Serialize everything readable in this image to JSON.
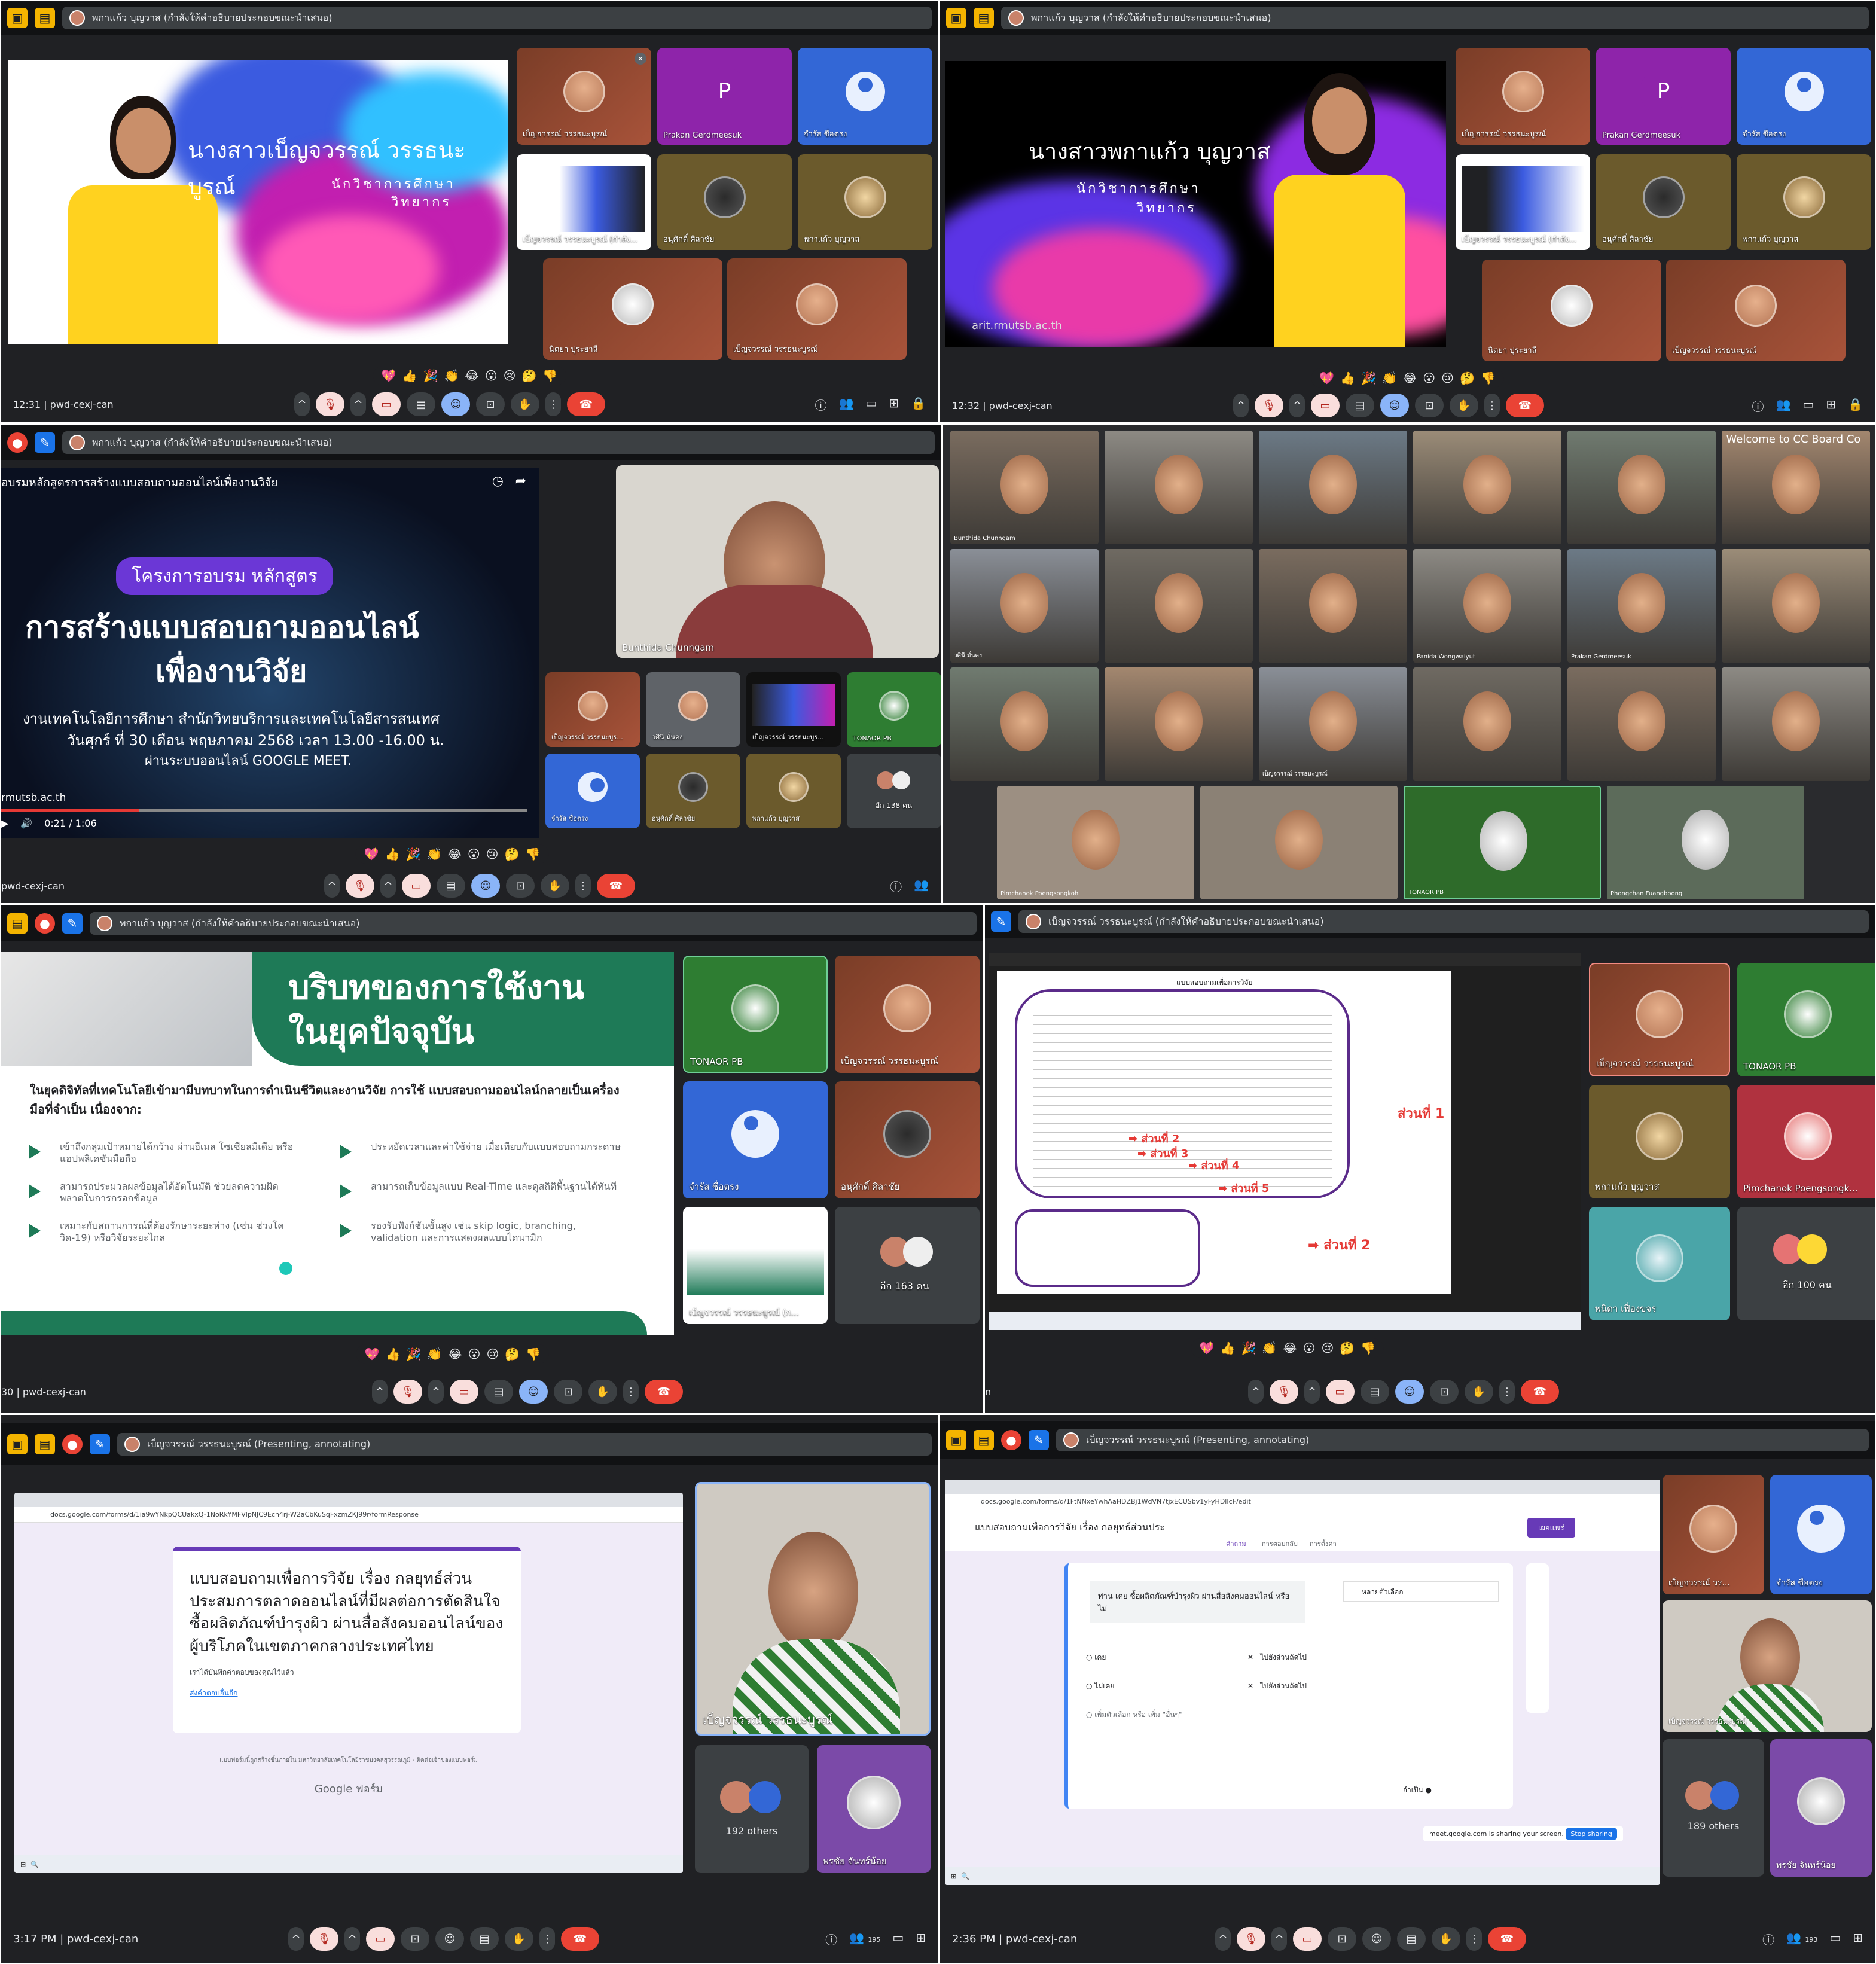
{
  "panel1": {
    "presenter_bar": "พกาแก้ว บุญวาส (กำลังให้คำอธิบายประกอบขณะนำเสนอ)",
    "slide_name": "นางสาวเบ็ญจวรรณ์ วรรธนะบูรณ์",
    "slide_role1": "นักวิชาการศึกษา",
    "slide_role2": "วิทยากร",
    "tiles": [
      "เบ็ญจวรรณ์ วรรธนะบูรณ์",
      "Prakan Gerdmeesuk",
      "จำรัส ซื่อตรง",
      "เบ็ญจวรรณ์ วรรธนะบูรณ์ (กำลัง...",
      "อนุศักดิ์ ศิลาชัย",
      "พกาแก้ว บุญวาส",
      "นิตยา ปุระยาลี",
      "เบ็ญจวรรณ์ วรรธนะบูรณ์"
    ],
    "tile_letter": "P",
    "time": "12:31",
    "meet_code": "pwd-cexj-can"
  },
  "panel2": {
    "presenter_bar": "พกาแก้ว บุญวาส (กำลังให้คำอธิบายประกอบขณะนำเสนอ)",
    "slide_name": "นางสาวพกาแก้ว บุญวาส",
    "slide_role1": "นักวิชาการศึกษา",
    "slide_role2": "วิทยากร",
    "slide_url": "arit.rmutsb.ac.th",
    "tiles": [
      "เบ็ญจวรรณ์ วรรธนะบูรณ์",
      "Prakan Gerdmeesuk",
      "จำรัส ซื่อตรง",
      "เบ็ญจวรรณ์ วรรธนะบูรณ์ (กำลัง...",
      "อนุศักดิ์ ศิลาชัย",
      "พกาแก้ว บุญวาส",
      "นิตยา ปุระยาลี",
      "เบ็ญจวรรณ์ วรรธนะบูรณ์"
    ],
    "tile_letter": "P",
    "time": "12:32",
    "meet_code": "pwd-cexj-can"
  },
  "panel3": {
    "presenter_bar": "พกาแก้ว บุญวาส (กำลังให้คำอธิบายประกอบขณะนำเสนอ)",
    "video_title": "อบรมหลักสูตรการสร้างแบบสอบถามออนไลน์เพื่องานวิจัย",
    "badge": "โครงการอบรม หลักสูตร",
    "heading1": "การสร้างแบบสอบถามออนไลน์",
    "heading2": "เพื่องานวิจัย",
    "line1": "งานเทคโนโลยีการศึกษา สำนักวิทยบริการและเทคโนโลยีสารสนเทศ",
    "line2": "วันศุกร์ ที่ 30 เดือน พฤษภาคม 2568 เวลา 13.00 -16.00 น.",
    "line3": "ผ่านระบบออนไลน์ GOOGLE MEET.",
    "url_fragment": "rmutsb.ac.th",
    "video_time": "0:21 / 1:06",
    "main_tile_name": "Bunthida Chunngam",
    "tiles": [
      "เบ็ญจวรรณ์ วรรธนะบูร...",
      "วศินี มั่นคง",
      "เบ็ญจวรรณ์ วรรธนะบูร...",
      "TONAOR PB",
      "จำรัส ซื่อตรง",
      "อนุศักดิ์ ศิลาชัย",
      "พกาแก้ว บุญวาส",
      "อีก 138 คน"
    ],
    "meet_code": "pwd-cexj-can"
  },
  "panel4": {
    "names": [
      "Bunthida Chunngam",
      "",
      "",
      "",
      "",
      "",
      "วศินี มั่นคง",
      "",
      "",
      "Panida Wongwaiyut",
      "Prakan Gerdmeesuk",
      "",
      "",
      "",
      "เบ็ญจวรรณ์ วรรธนะบูรณ์",
      "",
      "",
      "",
      "Pimchanok Poengsongkoh",
      "",
      "TONAOR PB",
      "Phongchan Fuangboong"
    ],
    "wall_text": "Welcome to CC Board Co"
  },
  "panel5": {
    "presenter_bar": "พกาแก้ว บุญวาส (กำลังให้คำอธิบายประกอบขณะนำเสนอ)",
    "banner_line1": "บริบทของการใช้งาน",
    "banner_line2": "ในยุคปัจจุบัน",
    "intro": "ในยุคดิจิทัลที่เทคโนโลยีเข้ามามีบทบาทในการดำเนินชีวิตและงานวิจัย การใช้ แบบสอบถามออนไลน์กลายเป็นเครื่องมือที่จำเป็น เนื่องจาก:",
    "bullets_left": [
      "เข้าถึงกลุ่มเป้าหมายได้กว้าง ผ่านอีเมล โซเชียลมีเดีย หรือแอปพลิเคชันมือถือ",
      "สามารถประมวลผลข้อมูลได้อัตโนมัติ ช่วยลดความผิดพลาดในการกรอกข้อมูล",
      "เหมาะกับสถานการณ์ที่ต้องรักษาระยะห่าง (เช่น ช่วงโควิด-19) หรือวิจัยระยะไกล"
    ],
    "bullets_right": [
      "ประหยัดเวลาและค่าใช้จ่าย เมื่อเทียบกับแบบสอบถามกระดาษ",
      "สามารถเก็บข้อมูลแบบ Real-Time และดูสถิติพื้นฐานได้ทันที",
      "รองรับฟังก์ชันขั้นสูง เช่น skip logic, branching, validation และการแสดงผลแบบไดนามิก"
    ],
    "tiles": [
      "TONAOR PB",
      "เบ็ญจวรรณ์ วรรธนะบูรณ์",
      "จำรัส ซื่อตรง",
      "อนุศักดิ์ ศิลาชัย",
      "เบ็ญจวรรณ์ วรรธนะบูรณ์ (ก...",
      "อีก 163 คน"
    ],
    "time_fragment": "30",
    "meet_code": "pwd-cexj-can"
  },
  "panel6": {
    "presenter_bar": "เบ็ญจวรรณ์ วรรธนะบูรณ์ (กำลังให้คำอธิบายประกอบขณะนำเสนอ)",
    "doc_title": "แบบสอบถามเพื่อการวิจัย",
    "labels": [
      "ส่วนที่ 1",
      "ส่วนที่ 2",
      "ส่วนที่ 2",
      "ส่วนที่ 3",
      "ส่วนที่ 4",
      "ส่วนที่ 5"
    ],
    "tiles": [
      "เบ็ญจวรรณ์ วรรธนะบูรณ์",
      "TONAOR PB",
      "พกาแก้ว บุญวาส",
      "Pimchanok Poengsongk...",
      "พนิดา เฟื่องขจร",
      "อีก 100 คน"
    ],
    "time_fragment": "n",
    "meet_code": ""
  },
  "panel7": {
    "presenter_bar": "เบ็ญจวรรณ์ วรรธนะบูรณ์ (Presenting, annotating)",
    "url": "docs.google.com/forms/d/1ia9wYNkpQCUakxQ-1NoRkYMFVlpNJC9Ech4rj-W2aCbKuSqFxzmZKJ99r/formResponse",
    "form_title": "แบบสอบถามเพื่อการวิจัย เรื่อง กลยุทธ์ส่วนประสมการตลาดออนไลน์ที่มีผลต่อการตัดสินใจซื้อผลิตภัณฑ์บำรุงผิว ผ่านสื่อสังคมออนไลน์ของผู้บริโภคในเขตภาคกลางประเทศไทย",
    "form_note": "เราได้บันทึกคำตอบของคุณไว้แล้ว",
    "form_link": "ส่งคำตอบอื่นอีก",
    "footer_note": "แบบฟอร์มนี้ถูกสร้างขึ้นภายใน มหาวิทยาลัยเทคโนโลยีราชมงคลสุวรรณภูมิ - ติดต่อเจ้าของแบบฟอร์ม",
    "google_forms": "Google ฟอร์ม",
    "main_tile_name": "เบ็ญจวรรณ์ วรรธนะบูรณ์",
    "others": "192 others",
    "tile_name": "พรชัย จันทร์น้อย",
    "time": "3:17 PM",
    "meet_code": "pwd-cexj-can",
    "count": "195"
  },
  "panel8": {
    "presenter_bar": "เบ็ญจวรรณ์ วรรธนะบูรณ์ (Presenting, annotating)",
    "url": "docs.google.com/forms/d/1FtNNxeYwhAaHDZBj1WdVN7tjxECUSbv1yFyHDlIcF/edit",
    "form_title": "แบบสอบถามเพื่อการวิจัย เรื่อง กลยุทธ์ส่วนประ",
    "tabs": [
      "คำถาม",
      "การตอบกลับ",
      "การตั้งค่า"
    ],
    "question": "ท่าน เคย ซื้อผลิตภัณฑ์บำรุงผิว ผ่านสื่อสังคมออนไลน์ หรือไม่",
    "type": "หลายตัวเลือก",
    "options": [
      "เคย",
      "ไม่เคย"
    ],
    "goto": [
      "ไปยังส่วนถัดไป",
      "ไปยังส่วนถัดไป"
    ],
    "add_option": "เพิ่มตัวเลือก หรือ เพิ่ม \"อื่นๆ\"",
    "required": "จำเป็น",
    "send_button": "เผยแพร่",
    "sharing_text": "meet.google.com is sharing your screen.",
    "stop_sharing": "Stop sharing",
    "tiles": [
      "เบ็ญจวรรณ์ วร...",
      "จำรัส ซื่อตรง",
      "เบ็ญจวรรณ์ วรรธนะบูรณ์",
      "พรชัย จันทร์น้อย"
    ],
    "others": "189 others",
    "time": "2:36 PM",
    "meet_code": "pwd-cexj-can",
    "count": "193"
  },
  "reactions": [
    "💖",
    "👍",
    "🎉",
    "👏",
    "😂",
    "😮",
    "😢",
    "🤔",
    "👎"
  ],
  "colors": {
    "meet_red": "#ea4335",
    "meet_bg": "#202124",
    "slide_green": "#1e7a57",
    "annot_red": "#e53935"
  }
}
